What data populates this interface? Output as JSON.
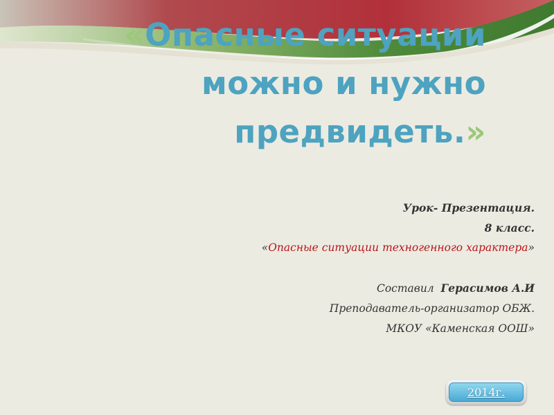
{
  "title": {
    "quote_open": "«",
    "line1": "Опасные ситуации",
    "line2": "можно и нужно",
    "line3": "предвидеть.",
    "quote_close": "»"
  },
  "info": {
    "line1": "Урок- Презентация.",
    "line2": "8 класс.",
    "topic_quote_open": "«",
    "topic": "Опасные ситуации техногенного характера",
    "topic_quote_close": "»",
    "author_label": "Составил",
    "author_name": "Герасимов А.И",
    "position": "Преподаватель-организатор ОБЖ.",
    "school": "МКОУ «Каменская ООШ»"
  },
  "year_button": {
    "label": "2014г."
  },
  "colors": {
    "title": "#4da3c0",
    "quotes": "#9bc87a",
    "topic": "#b8151b",
    "background": "#ecebe2",
    "swoosh_red": "#b4323a",
    "swoosh_green": "#5f9a46"
  }
}
